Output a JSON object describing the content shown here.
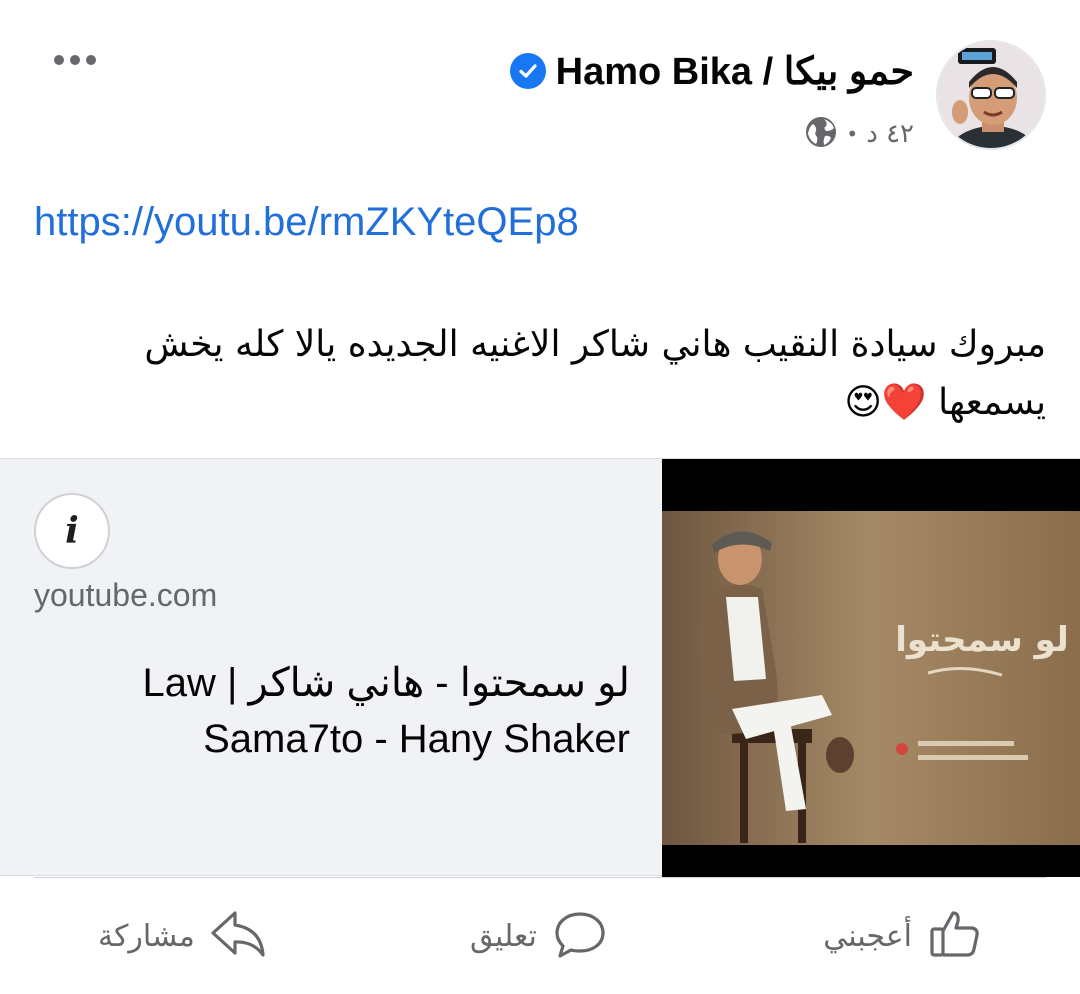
{
  "post": {
    "author_name": "حمو بيكا / Hamo Bika",
    "verified": true,
    "time": "٤٢ د",
    "separator": "•",
    "privacy_icon": "globe-icon",
    "more_icon": "more-horizontal-icon",
    "link_url": "https://youtu.be/rmZKYteQEp8",
    "text": "مبروك سيادة  النقيب هاني شاكر الاغنيه  الجديده يالا كله يخش يسمعها ❤️😍"
  },
  "link_card": {
    "info_icon": "i",
    "domain": "youtube.com",
    "title": "لو سمحتوا - هاني شاكر | Law Sama7to - Hany Shaker",
    "thumbnail_overlay_text": "لو سمحتوا"
  },
  "actions": {
    "like_label": "أعجبني",
    "comment_label": "تعليق",
    "share_label": "مشاركة"
  },
  "colors": {
    "link": "#216fdb",
    "verified": "#1877f2",
    "secondary_text": "#65676b",
    "card_background": "#f0f2f5"
  }
}
